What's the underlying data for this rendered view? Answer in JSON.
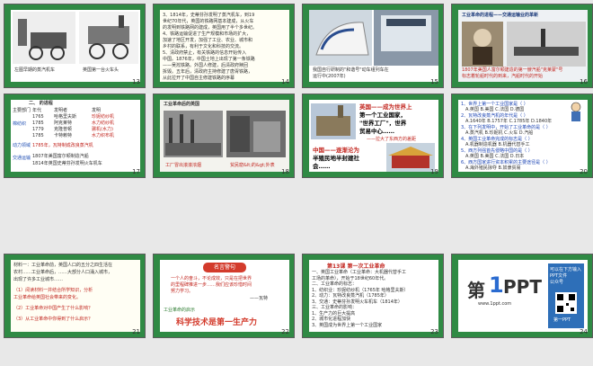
{
  "slides": [
    {
      "n": "13",
      "captions": [
        "左图早期的蒸汽机车",
        "英国第一台火车头"
      ]
    },
    {
      "n": "14",
      "lines": [
        "3、1814年，史蒂芬孙发明了蒸汽机车，到19",
        "世纪70年代，英国的铁路网基本建成，从火车",
        "的发明到铁路网的建成，英国用了半个多世纪。",
        "4、铁路运输促进了生产规模和市场的扩大，",
        "加速了地区开发，加强了工业、农业、城市和",
        "乡村的联系，有利于文化和科技的交流。",
        "5、清政府禁止，有关铁路的信息开始传入",
        "中国。1876年，中国土地上出现了第一条铁路",
        "——吴淞铁路。外国人修建，后清政府赎回",
        "拆毁。五年后，清政府主持修建了唐胥铁路，",
        "从此拉开了中国自主修建铁路的序幕"
      ]
    },
    {
      "n": "15",
      "caption": [
        "我国自行研制的\"和谐号\"动车组列车在",
        "运行中(2007年)"
      ]
    },
    {
      "n": "16",
      "title": "工业革命的进程——交通运输业的革新",
      "caption": [
        "1807年美国人富尔顿建造的第一艘汽船\"克莱蒙\"号",
        "标志着轮船时代的到来，汽船时代的开始"
      ]
    },
    {
      "n": "17",
      "header": "二、    的进程",
      "table_head": [
        "主要部门",
        "年代",
        "发明者",
        "发明"
      ],
      "rows": [
        [
          "1765",
          "哈格里夫斯",
          "珍妮纺纱机"
        ],
        [
          "1785",
          "阿克莱特",
          "水力纺纱机"
        ],
        [
          "1779",
          "克隆普顿",
          "骡机(水力)"
        ],
        [
          "1785",
          "卡特赖特",
          "水力织布机"
        ]
      ],
      "side": [
        "棉纺织",
        "动力领域",
        "交通运输"
      ],
      "power": "1785年，瓦特制成改良蒸汽机",
      "traffic": [
        "1807年美国富尔顿制造汽船",
        "1814年英国史蒂芬孙发明火车机车"
      ]
    },
    {
      "n": "18",
      "title": "工业革命后的英国",
      "captions": [
        "工厂冒出滚滚浓烟",
        "贫民窟&lt;的&gt;外表"
      ]
    },
    {
      "n": "19",
      "text": [
        "英国——成为世界上",
        "第一个工业国家，",
        "\"世界工厂\"，世界",
        "贸易中心……"
      ],
      "sub": "——拉大了东西方的差距",
      "text2": [
        "中国——逐渐沦为",
        "半殖民地半封建社",
        "会……"
      ]
    },
    {
      "n": "20",
      "qs": [
        "1、世界上第一个工业国家是（    ）",
        "A.英国  B.美国  C.法国  D.德国",
        "2、瓦特改良蒸汽机的年代是（    ）",
        "A.1640年 B.1757年 C.1785年 D.1840年",
        "3、在下列发明中，开始了工业革命的是（    ）",
        "A.蒸汽机 B.珍妮机 C.火车 D.汽船",
        "4、英国工业革命完成的标志是（    ）",
        "A.机器制造机器 B.机器代替手工",
        "5、西方列强首先侵略中国的是（    ）",
        "A.英国 B.美国 C.法国 D.日本",
        "6、西方国家进行资本积累的主要途径是（    ）",
        "A.海外殖民掠夺 B.奴隶贸易"
      ]
    },
    {
      "n": "21",
      "lines": [
        "材料一：工业革命前，英国人口的五分之四生活在",
        "农村……工业革命后，……大部分人口涌入城市，",
        "出现了许多工业城市……",
        "（1）阅读材料一并结合所学知识，分析",
        "工业革命给英国社会带来的变化。",
        "（2）工业革命对中国产生了什么影响？",
        "（3）从工业革命中你得到了什么启示？"
      ]
    },
    {
      "n": "22",
      "banner": "名言警句",
      "quote": [
        "一个人的奋斗，不论成效，只是在把世界",
        "的里程碑推进一步……我们应该珍惜时间",
        "努力学习。"
      ],
      "author": "——瓦特",
      "hint": "工业革命的启示",
      "big": "科学技术是第一生产力"
    },
    {
      "n": "23",
      "title": "第13课    第一次工业革命",
      "lines": [
        "一、英国工业革命（工业革命：大机器代替手工",
        "工场的革命），开始于18世纪60年代。",
        "二、工业革命的标志：",
        "1、纺织业：珍妮纺纱机（1765年 哈格里夫斯）",
        "2、动力：瓦特改良蒸汽机（1785年）",
        "3、交通：史蒂芬孙发明火车机车（1814年）",
        "三、工业革命的影响：",
        "1、生产力的巨大提高",
        "2、城市化进程加快",
        "3、英国成为世界上第一个工业国家"
      ]
    },
    {
      "n": "24",
      "logo_big": "第",
      "logo_one": "1",
      "logo_rest": "PPT",
      "logo_sub": "www.1ppt.com",
      "side_lines": [
        "可以在下方输入",
        "PPT文件",
        "公众号",
        "第一PPT"
      ]
    }
  ]
}
